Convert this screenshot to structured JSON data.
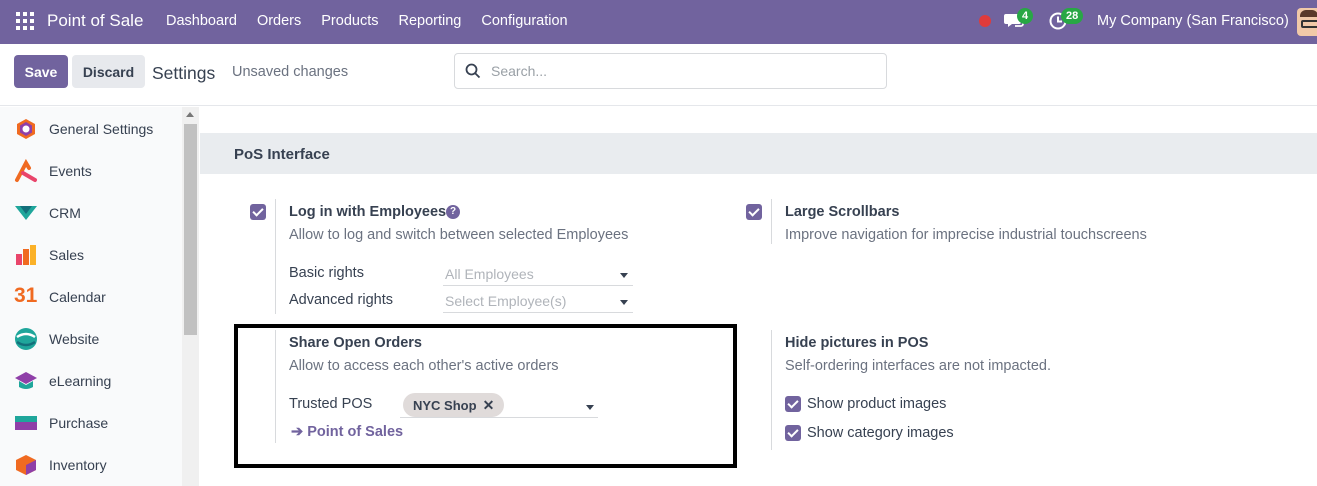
{
  "topbar": {
    "app_name": "Point of Sale",
    "nav": [
      "Dashboard",
      "Orders",
      "Products",
      "Reporting",
      "Configuration"
    ],
    "messages_count": "4",
    "activities_count": "28",
    "company": "My Company (San Francisco)"
  },
  "control": {
    "save_label": "Save",
    "discard_label": "Discard",
    "title": "Settings",
    "status": "Unsaved changes",
    "search_placeholder": "Search..."
  },
  "sidebar": {
    "items": [
      {
        "label": "General Settings",
        "icon": "general-settings-icon"
      },
      {
        "label": "Events",
        "icon": "events-icon"
      },
      {
        "label": "CRM",
        "icon": "crm-icon"
      },
      {
        "label": "Sales",
        "icon": "sales-icon"
      },
      {
        "label": "Calendar",
        "icon": "calendar-icon"
      },
      {
        "label": "Website",
        "icon": "website-icon"
      },
      {
        "label": "eLearning",
        "icon": "elearning-icon"
      },
      {
        "label": "Purchase",
        "icon": "purchase-icon"
      },
      {
        "label": "Inventory",
        "icon": "inventory-icon"
      }
    ],
    "calendar_number": "31"
  },
  "section": {
    "title": "PoS Interface"
  },
  "settings": {
    "login_employees": {
      "title": "Log in with Employees",
      "desc": "Allow to log and switch between selected Employees",
      "basic_rights_label": "Basic rights",
      "basic_rights_placeholder": "All Employees",
      "advanced_rights_label": "Advanced rights",
      "advanced_rights_placeholder": "Select Employee(s)"
    },
    "large_scrollbars": {
      "title": "Large Scrollbars",
      "desc": "Improve navigation for imprecise industrial touchscreens"
    },
    "share_orders": {
      "title": "Share Open Orders",
      "desc": "Allow to access each other's active orders",
      "trusted_label": "Trusted POS",
      "tag": "NYC Shop",
      "link": "Point of Sales"
    },
    "hide_pictures": {
      "title": "Hide pictures in POS",
      "desc": "Self-ordering interfaces are not impacted.",
      "product_images": "Show product images",
      "category_images": "Show category images"
    }
  },
  "colors": {
    "brand": "#71639e",
    "badge": "#28a745",
    "record": "#e03b3b"
  }
}
